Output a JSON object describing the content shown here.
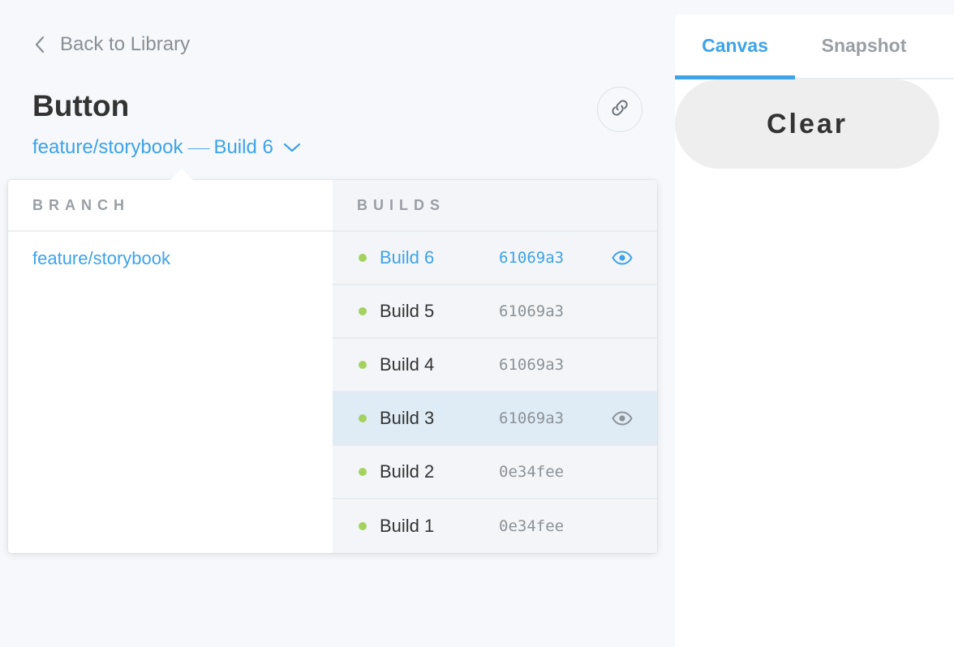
{
  "nav": {
    "back_label": "Back to Library"
  },
  "header": {
    "title": "Button",
    "branch": "feature/storybook",
    "build": "Build 6"
  },
  "dropdown": {
    "branch_heading": "BRANCH",
    "builds_heading": "BUILDS",
    "branches": [
      "feature/storybook"
    ],
    "builds": [
      {
        "name": "Build 6",
        "hash": "61069a3",
        "state": "active",
        "viewing": true
      },
      {
        "name": "Build 5",
        "hash": "61069a3",
        "state": "normal",
        "viewing": false
      },
      {
        "name": "Build 4",
        "hash": "61069a3",
        "state": "normal",
        "viewing": false
      },
      {
        "name": "Build 3",
        "hash": "61069a3",
        "state": "hover",
        "viewing": true
      },
      {
        "name": "Build 2",
        "hash": "0e34fee",
        "state": "normal",
        "viewing": false
      },
      {
        "name": "Build 1",
        "hash": "0e34fee",
        "state": "normal",
        "viewing": false
      }
    ]
  },
  "tabs": [
    {
      "label": "Canvas",
      "selected": true
    },
    {
      "label": "Snapshot",
      "selected": false
    }
  ],
  "preview": {
    "button_label": "Clear"
  },
  "colors": {
    "accent": "#3ea3e8",
    "status_green": "#a4d25f",
    "muted": "#9a9ea5",
    "hover_row": "#dfecf5"
  },
  "icons": {
    "back": "chevron-left-icon",
    "link": "link-icon",
    "dropdown": "chevron-down-icon",
    "status": "status-dot-icon",
    "view": "eye-icon"
  }
}
